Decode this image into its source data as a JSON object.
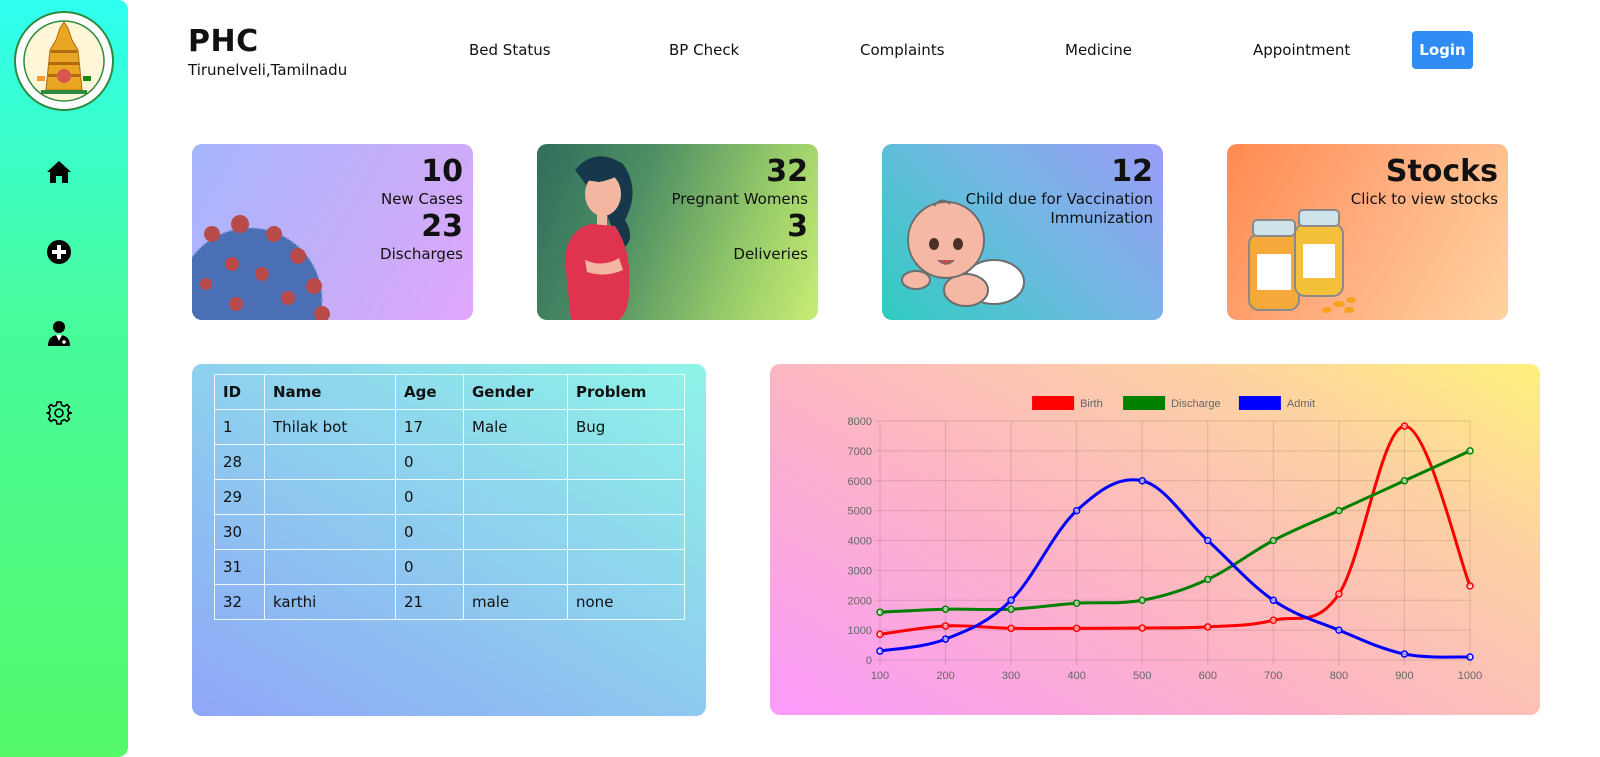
{
  "header": {
    "title": "PHC",
    "subtitle": "Tirunelveli,Tamilnadu",
    "nav": [
      "Bed Status",
      "BP Check",
      "Complaints",
      "Medicine",
      "Appointment"
    ],
    "login_label": "Login",
    "login_color": "#2f8cf2"
  },
  "sidebar": {
    "logo": "tamil-nadu-emblem",
    "items": [
      {
        "icon": "home-icon"
      },
      {
        "icon": "plus-circle-icon"
      },
      {
        "icon": "doctor-icon"
      },
      {
        "icon": "gear-icon"
      }
    ]
  },
  "cards": [
    {
      "num1": "10",
      "label1": "New Cases",
      "num2": "23",
      "label2": "Discharges",
      "image": "virus-illustration"
    },
    {
      "num1": "32",
      "label1": "Pregnant Womens",
      "num2": "3",
      "label2": "Deliveries",
      "image": "pregnant-woman-illustration"
    },
    {
      "num1": "12",
      "label1": "Child due for Vaccination",
      "label2": "Immunization",
      "image": "baby-illustration"
    },
    {
      "title": "Stocks",
      "label1": "Click to view stocks",
      "image": "medicine-bottles-illustration"
    }
  ],
  "table": {
    "headers": [
      "ID",
      "Name",
      "Age",
      "Gender",
      "Problem"
    ],
    "rows": [
      [
        "1",
        "Thilak bot",
        "17",
        "Male",
        "Bug"
      ],
      [
        "28",
        "",
        "0",
        "",
        ""
      ],
      [
        "29",
        "",
        "0",
        "",
        ""
      ],
      [
        "30",
        "",
        "0",
        "",
        ""
      ],
      [
        "31",
        "",
        "0",
        "",
        ""
      ],
      [
        "32",
        "karthi",
        "21",
        "male",
        "none"
      ]
    ]
  },
  "chart_data": {
    "type": "line",
    "x": [
      100,
      200,
      300,
      400,
      500,
      600,
      700,
      800,
      900,
      1000
    ],
    "ylim": [
      0,
      8000
    ],
    "yticks": [
      0,
      1000,
      2000,
      3000,
      4000,
      5000,
      6000,
      7000,
      8000
    ],
    "grid": true,
    "legend_position": "top",
    "series": [
      {
        "name": "Birth",
        "color": "#ff0000",
        "values": [
          860,
          1140,
          1060,
          1060,
          1070,
          1110,
          1330,
          2210,
          7830,
          2480
        ]
      },
      {
        "name": "Discharge",
        "color": "#008000",
        "values": [
          1600,
          1700,
          1700,
          1900,
          2000,
          2700,
          4000,
          5000,
          6000,
          7000
        ]
      },
      {
        "name": "Admit",
        "color": "#0000ff",
        "values": [
          300,
          700,
          2000,
          5000,
          6000,
          4000,
          2000,
          1000,
          200,
          100
        ]
      }
    ]
  }
}
